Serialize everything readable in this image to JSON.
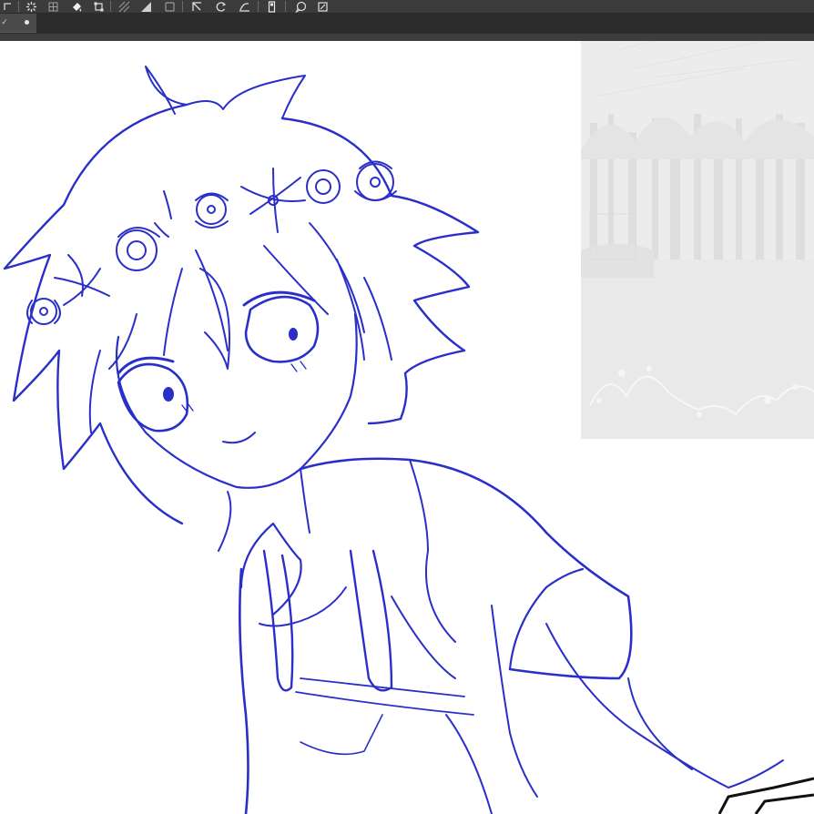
{
  "app": {
    "name": "",
    "accent_color": "#2a2fc9"
  },
  "toolbar": {
    "icons": [
      "lasso-select-icon",
      "magic-wand-icon",
      "fill-bucket-icon",
      "transform-icon",
      "grid-icon",
      "gradient-icon",
      "layer-mask-icon",
      "move-icon",
      "rotate-icon",
      "curve-icon",
      "ruler-icon",
      "speech-bubble-icon",
      "fit-canvas-icon"
    ]
  },
  "canvas": {
    "background_color": "#ffffff",
    "sketch_color": "#2a2fc9",
    "reference_layer_color": "#ececec"
  }
}
